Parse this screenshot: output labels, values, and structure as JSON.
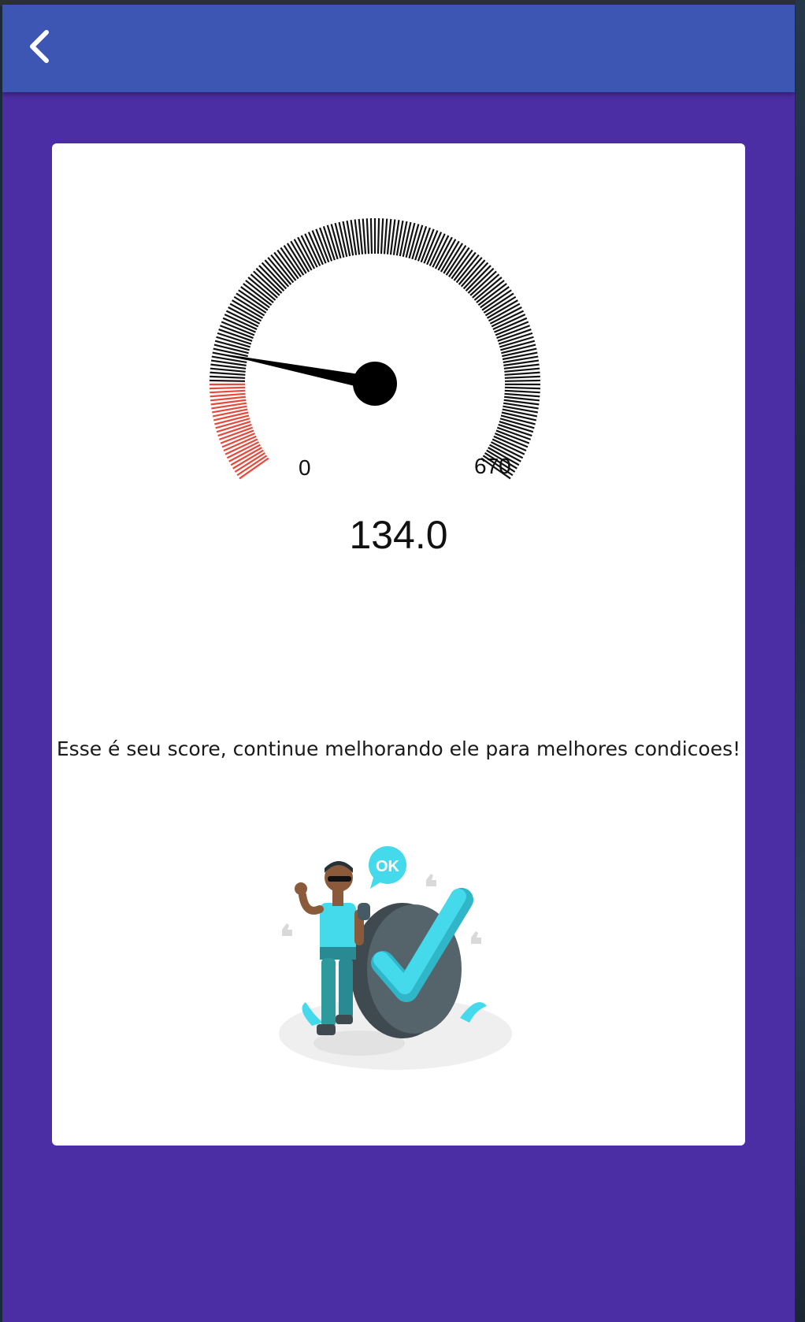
{
  "appbar": {
    "back_icon": "chevron-left-icon"
  },
  "gauge": {
    "min_label": "0",
    "max_label": "670",
    "value": 134.0,
    "min": 0,
    "max": 670,
    "value_label": "134.0",
    "danger_color": "#e8473b",
    "tick_color": "#111111"
  },
  "message": "Esse é seu score, continue melhorando ele para melhores condicoes!",
  "illustration": {
    "badge_text": "OK",
    "accent_color": "#45d9ec"
  },
  "colors": {
    "appbar": "#3e56b3",
    "background": "#4b2ea3",
    "card": "#ffffff"
  }
}
